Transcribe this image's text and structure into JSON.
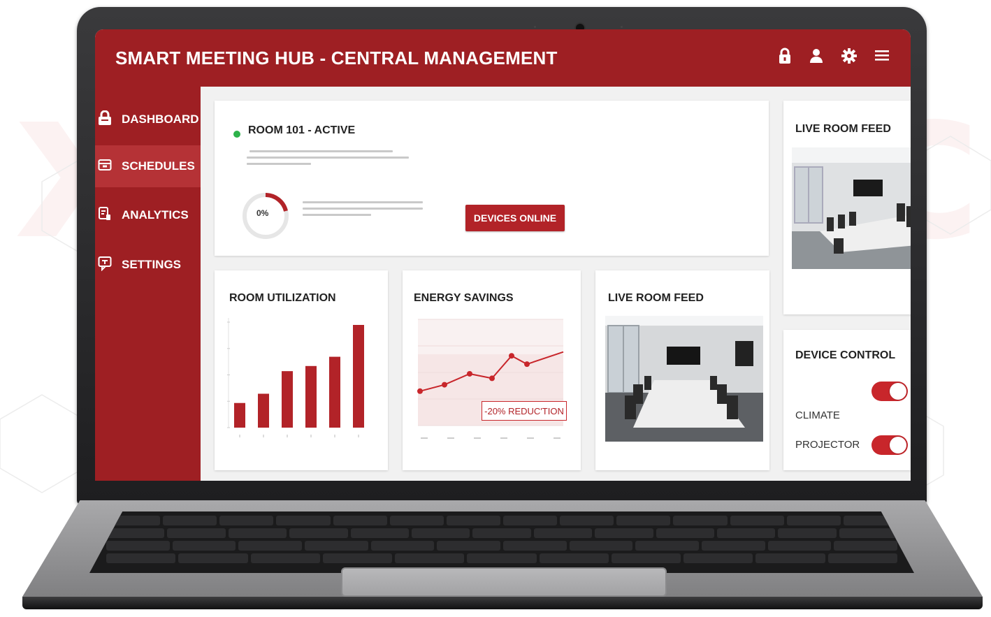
{
  "header": {
    "title": "SMART MEETING HUB - CENTRAL MANAGEMENT",
    "icons": [
      "lock-icon",
      "user-icon",
      "gear-icon",
      "menu-icon"
    ]
  },
  "sidebar": {
    "items": [
      {
        "label": "DASHBOARD",
        "icon": "lock-icon",
        "active": false
      },
      {
        "label": "SCHEDULES",
        "icon": "calendar-icon",
        "active": true
      },
      {
        "label": "ANALYTICS",
        "icon": "analytics-icon",
        "active": false
      },
      {
        "label": "SETTINGS",
        "icon": "settings-icon",
        "active": false
      }
    ]
  },
  "room_status": {
    "title": "ROOM 101 - ACTIVE",
    "status_color": "#2db24a",
    "gauge_label": "0%",
    "gauge_value": 0,
    "devices_button": "DEVICES ONLINE"
  },
  "room_utilization": {
    "title": "ROOM UTILIZATION"
  },
  "energy_savings": {
    "title": "ENERGY SAVINGS",
    "annotation": "-20% REDUC'TION"
  },
  "live_feed_main": {
    "title": "LIVE ROOM FEED"
  },
  "live_feed_side": {
    "title": "LIVE ROOM FEED"
  },
  "device_control": {
    "title": "DEVICE CONTROL",
    "devices": [
      {
        "label": "CLIMATE",
        "on": true
      },
      {
        "label": "PROJECTOR",
        "on": true
      }
    ]
  },
  "colors": {
    "brand": "#9e1f23",
    "active_nav": "#b53236",
    "accent": "#c8262b"
  },
  "chart_data": [
    {
      "type": "bar",
      "title": "ROOM UTILIZATION",
      "values": [
        0.24,
        0.33,
        0.55,
        0.6,
        0.69,
        1.0
      ]
    },
    {
      "type": "line",
      "title": "ENERGY SAVINGS",
      "values": [
        0.1,
        0.2,
        0.37,
        0.3,
        0.65,
        0.52,
        0.71
      ]
    }
  ]
}
